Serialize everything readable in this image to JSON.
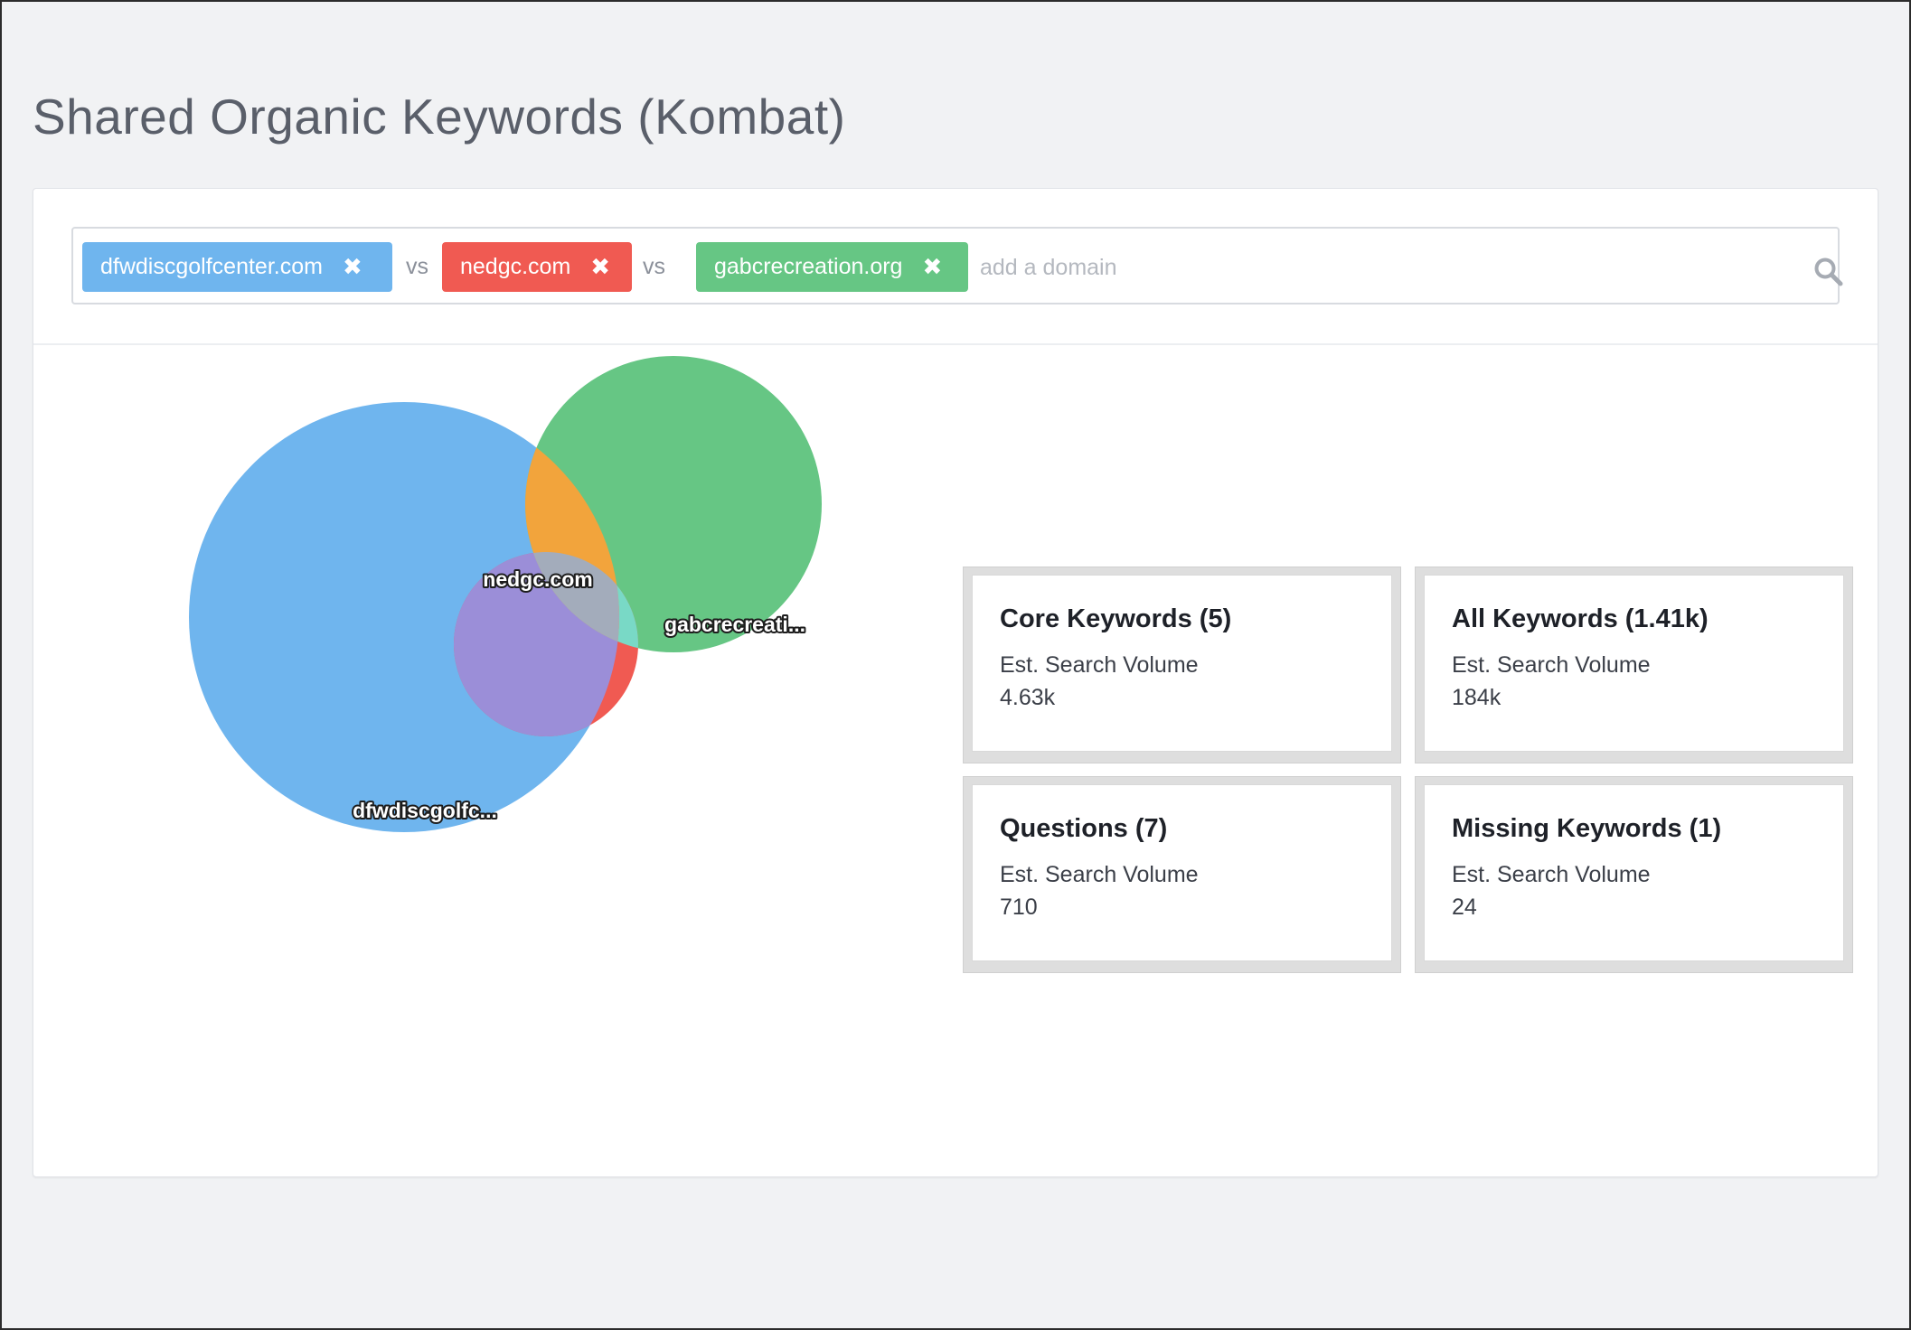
{
  "page": {
    "title": "Shared Organic Keywords (Kombat)"
  },
  "search": {
    "domains": [
      {
        "label": "dfwdiscgolfcenter.com",
        "color": "#6fb5ee"
      },
      {
        "label": "nedgc.com",
        "color": "#f05a52"
      },
      {
        "label": "gabcrecreation.org",
        "color": "#66c684"
      }
    ],
    "separator": "vs",
    "remove_icon": "times-icon",
    "placeholder": "add a domain",
    "search_icon": "search-icon"
  },
  "venn": {
    "labels": {
      "blue": "dfwdiscgolfc...",
      "red": "nedgc.com",
      "green": "gabcrecreati..."
    },
    "colors": {
      "blue": "#6fb5ee",
      "red": "#f05a52",
      "green": "#66c684",
      "blue_red": "#9b8ed8",
      "red_green": "#79d9c6",
      "blue_green": "#f2a43c",
      "all_three": "#a3acbb"
    }
  },
  "stats": [
    {
      "title": "Core Keywords (5)",
      "subtitle": "Est. Search Volume",
      "value": "4.63k"
    },
    {
      "title": "All Keywords (1.41k)",
      "subtitle": "Est. Search Volume",
      "value": "184k"
    },
    {
      "title": "Questions (7)",
      "subtitle": "Est. Search Volume",
      "value": "710"
    },
    {
      "title": "Missing Keywords (1)",
      "subtitle": "Est. Search Volume",
      "value": "24"
    }
  ]
}
